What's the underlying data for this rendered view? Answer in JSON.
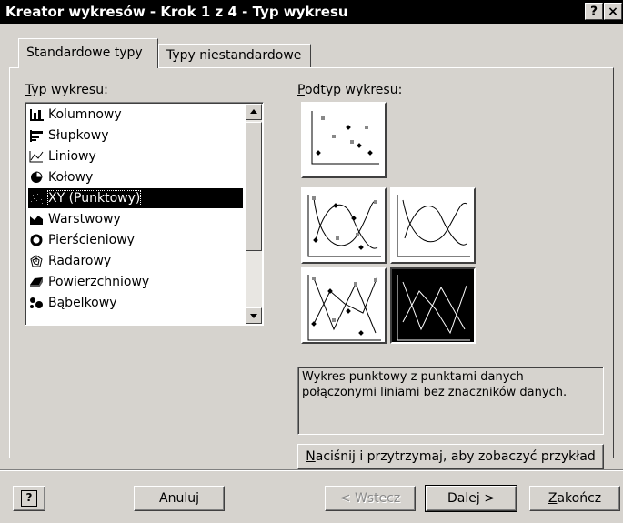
{
  "window": {
    "title": "Kreator wykresów - Krok 1 z 4 - Typ wykresu",
    "help_glyph": "?",
    "close_glyph": "×"
  },
  "tabs": [
    {
      "label": "Standardowe typy",
      "active": true
    },
    {
      "label": "Typy niestandardowe",
      "active": false
    }
  ],
  "chart_type": {
    "label_underlined": "T",
    "label_rest": "yp wykresu:",
    "items": [
      {
        "label": "Kolumnowy",
        "icon": "column-chart-icon",
        "selected": false
      },
      {
        "label": "Słupkowy",
        "icon": "bar-chart-icon",
        "selected": false
      },
      {
        "label": "Liniowy",
        "icon": "line-chart-icon",
        "selected": false
      },
      {
        "label": "Kołowy",
        "icon": "pie-chart-icon",
        "selected": false
      },
      {
        "label": "XY (Punktowy)",
        "icon": "xy-scatter-icon",
        "selected": true
      },
      {
        "label": "Warstwowy",
        "icon": "area-chart-icon",
        "selected": false
      },
      {
        "label": "Pierścieniowy",
        "icon": "doughnut-chart-icon",
        "selected": false
      },
      {
        "label": "Radarowy",
        "icon": "radar-chart-icon",
        "selected": false
      },
      {
        "label": "Powierzchniowy",
        "icon": "surface-chart-icon",
        "selected": false
      },
      {
        "label": "Bąbelkowy",
        "icon": "bubble-chart-icon",
        "selected": false
      }
    ]
  },
  "subtype": {
    "label_underlined": "P",
    "label_rest": "odtyp wykresu:",
    "items": [
      {
        "name": "scatter-markers",
        "selected": false
      },
      {
        "name": "smoothed-lines-markers",
        "selected": false
      },
      {
        "name": "smoothed-lines",
        "selected": false
      },
      {
        "name": "straight-lines-markers",
        "selected": false
      },
      {
        "name": "straight-lines",
        "selected": true
      }
    ],
    "description": "Wykres punktowy z punktami danych połączonymi liniami bez znaczników danych."
  },
  "preview_button": {
    "underlined": "N",
    "rest": "aciśnij i przytrzymaj, aby zobaczyć przykład"
  },
  "footer": {
    "help_icon_glyph": "?",
    "cancel": "Anuluj",
    "back": "< Wstecz",
    "next": "Dalej >",
    "finish_underlined": "Z",
    "finish_rest": "akończ"
  },
  "colors": {
    "title_bg": "#000000",
    "dialog_bg": "#d6d3ce",
    "selection": "#000000"
  }
}
